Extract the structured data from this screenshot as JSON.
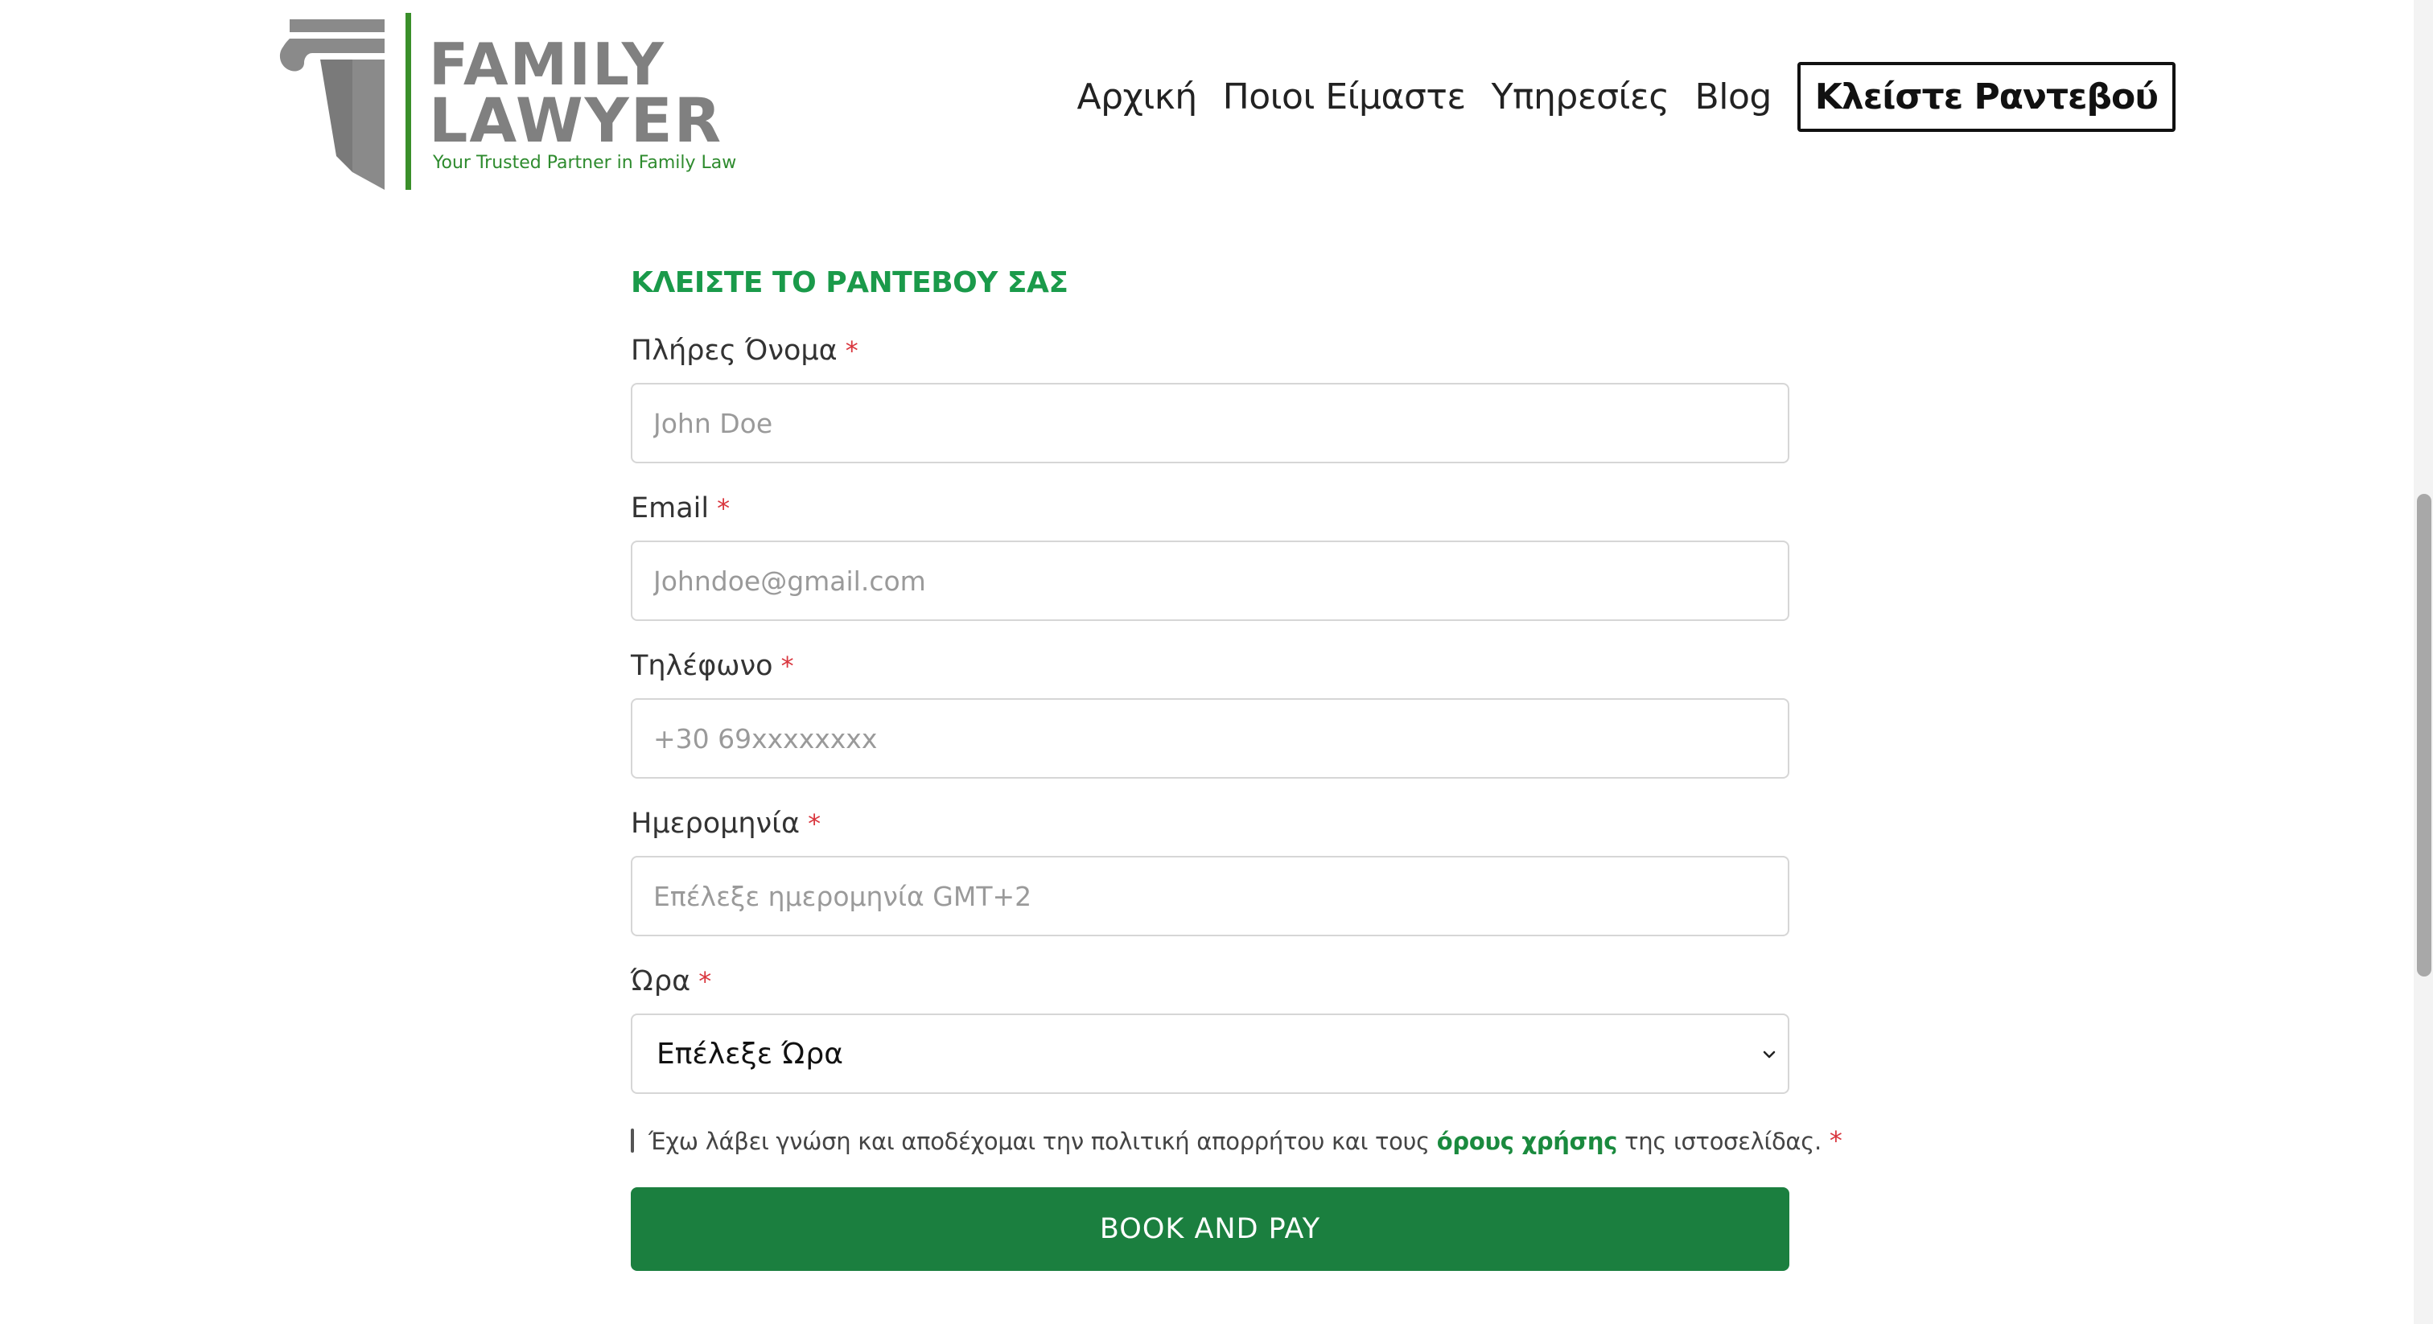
{
  "logo": {
    "word1": "FAMILY",
    "word2": "LAWYER",
    "tagline": "Your Trusted Partner in Family Law"
  },
  "nav": {
    "items": [
      "Αρχική",
      "Ποιοι Είμαστε",
      "Υπηρεσίες",
      "Blog"
    ],
    "cta": "Κλείστε Ραντεβού"
  },
  "form": {
    "title": "ΚΛΕΙΣΤΕ ΤΟ ΡΑΝΤΕΒΟΥ ΣΑΣ",
    "required_mark": "*",
    "fields": {
      "name": {
        "label": "Πλήρες Όνομα",
        "placeholder": "John Doe"
      },
      "email": {
        "label": "Email",
        "placeholder": "Johndoe@gmail.com"
      },
      "phone": {
        "label": "Τηλέφωνο",
        "placeholder": "+30 69xxxxxxxx"
      },
      "date": {
        "label": "Ημερομηνία",
        "placeholder": "Επέλεξε ημερομηνία GMT+2"
      },
      "time": {
        "label": "Ώρα",
        "selected": "Επέλεξε Ώρα"
      }
    },
    "consent": {
      "before": "Έχω λάβει γνώση και αποδέχομαι την πολιτική απορρήτου και τους ",
      "link": "όρους χρήσης",
      "after": " της ιστοσελίδας."
    },
    "submit": "BOOK AND PAY"
  },
  "colors": {
    "accent_green": "#1b7f3f",
    "title_green": "#1a9a4a",
    "required_red": "#d9363e",
    "logo_gray": "#808080"
  }
}
